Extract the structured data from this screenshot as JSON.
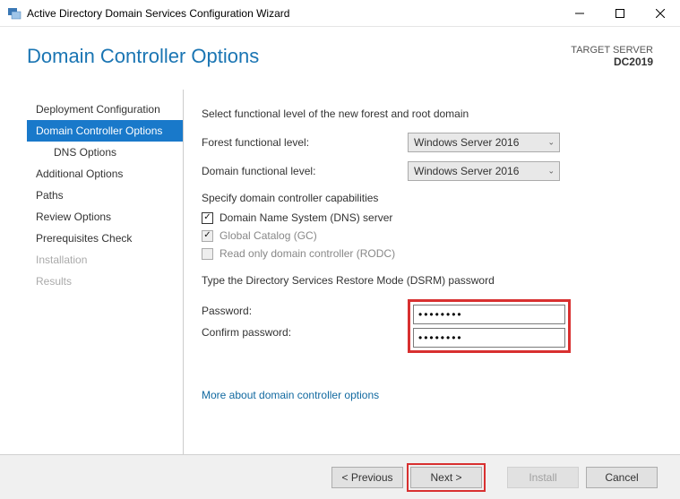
{
  "window": {
    "title": "Active Directory Domain Services Configuration Wizard"
  },
  "header": {
    "title": "Domain Controller Options",
    "target_label": "TARGET SERVER",
    "target_name": "DC2019"
  },
  "nav": {
    "items": [
      {
        "label": "Deployment Configuration"
      },
      {
        "label": "Domain Controller Options"
      },
      {
        "label": "DNS Options"
      },
      {
        "label": "Additional Options"
      },
      {
        "label": "Paths"
      },
      {
        "label": "Review Options"
      },
      {
        "label": "Prerequisites Check"
      },
      {
        "label": "Installation"
      },
      {
        "label": "Results"
      }
    ]
  },
  "content": {
    "functional_section": "Select functional level of the new forest and root domain",
    "forest_label": "Forest functional level:",
    "forest_value": "Windows Server 2016",
    "domain_label": "Domain functional level:",
    "domain_value": "Windows Server 2016",
    "capabilities_section": "Specify domain controller capabilities",
    "dns_label": "Domain Name System (DNS) server",
    "gc_label": "Global Catalog (GC)",
    "rodc_label": "Read only domain controller (RODC)",
    "dsrm_section": "Type the Directory Services Restore Mode (DSRM) password",
    "password_label": "Password:",
    "confirm_label": "Confirm password:",
    "password_value": "••••••••",
    "confirm_value": "••••••••",
    "more_link": "More about domain controller options"
  },
  "footer": {
    "previous": "< Previous",
    "next": "Next >",
    "install": "Install",
    "cancel": "Cancel"
  }
}
